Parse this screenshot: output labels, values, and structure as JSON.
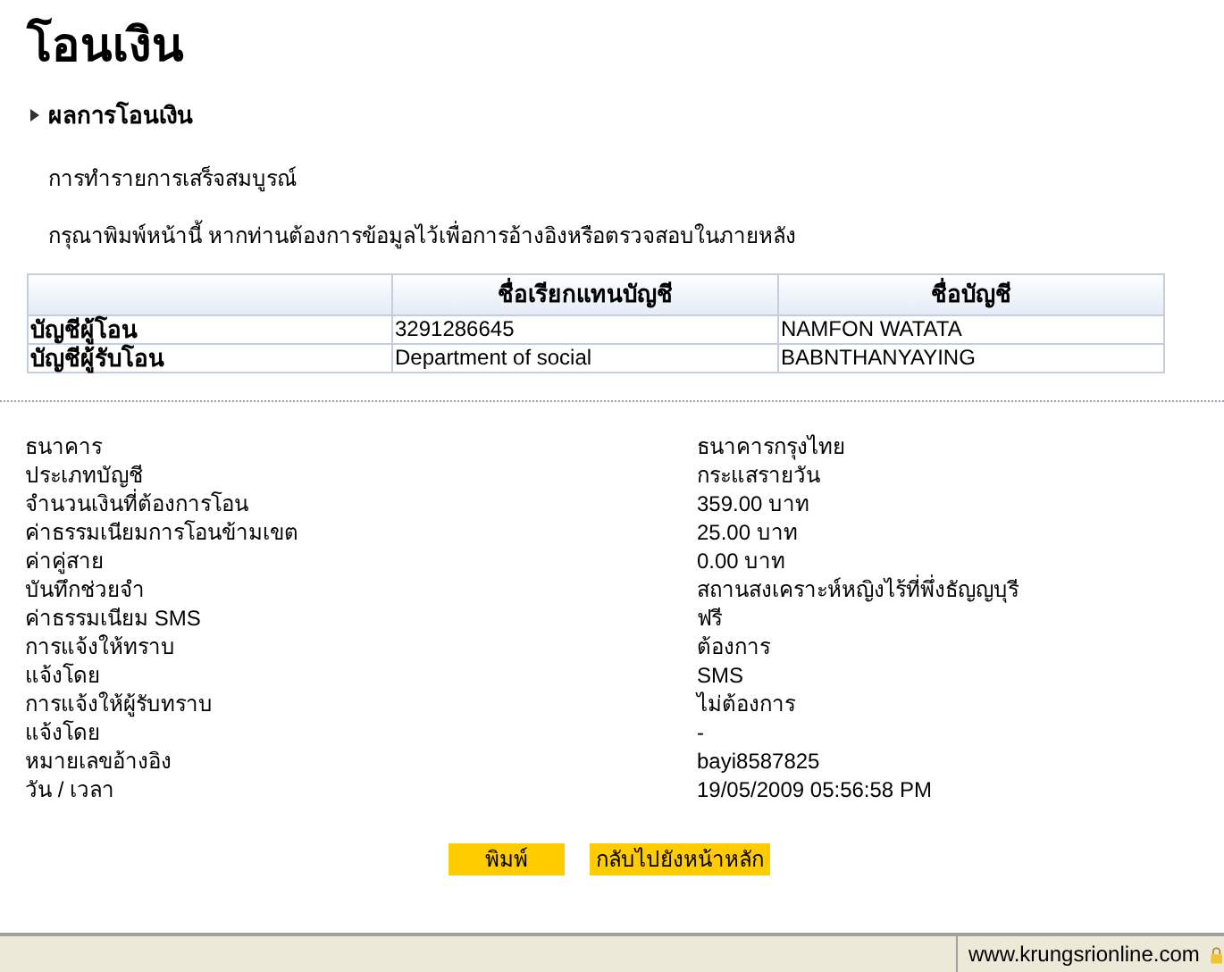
{
  "page_title": "โอนเงิน",
  "section": "ผลการโอนเงิน",
  "messages": [
    "การทำรายการเสร็จสมบูรณ์",
    "กรุณาพิมพ์หน้านี้ หากท่านต้องการข้อมูลไว้เพื่อการอ้างอิงหรือตรวจสอบในภายหลัง"
  ],
  "accounts_table": {
    "columns": [
      "ชื่อเรียกแทนบัญชี",
      "ชื่อบัญชี"
    ],
    "rows": [
      {
        "label": "บัญชีผู้โอน",
        "cells": [
          "3291286645",
          "NAMFON WATATA"
        ]
      },
      {
        "label": "บัญชีผู้รับโอน",
        "cells": [
          "Department of social",
          "BABNTHANYAYING"
        ]
      }
    ]
  },
  "details": [
    {
      "label": "ธนาคาร",
      "value": "ธนาคารกรุงไทย"
    },
    {
      "label": "ประเภทบัญชี",
      "value": "กระแสรายวัน"
    },
    {
      "label": "จำนวนเงินที่ต้องการโอน",
      "value": "359.00 บาท"
    },
    {
      "label": "ค่าธรรมเนียมการโอนข้ามเขต",
      "value": "25.00 บาท"
    },
    {
      "label": "ค่าคู่สาย",
      "value": "0.00 บาท"
    },
    {
      "label": "บันทึกช่วยจำ",
      "value": "สถานสงเคราะห์หญิงไร้ที่พึ่งธัญญบุรี"
    },
    {
      "label": "ค่าธรรมเนียม SMS",
      "value": "ฟรี"
    },
    {
      "label": "การแจ้งให้ทราบ",
      "value": "ต้องการ"
    },
    {
      "label": "แจ้งโดย",
      "value": "SMS"
    },
    {
      "label": "การแจ้งให้ผู้รับทราบ",
      "value": "ไม่ต้องการ"
    },
    {
      "label": "แจ้งโดย",
      "value": "-"
    },
    {
      "label": "หมายเลขอ้างอิง",
      "value": "bayi8587825"
    },
    {
      "label": "วัน / เวลา",
      "value": "19/05/2009 05:56:58 PM"
    }
  ],
  "buttons": [
    "พิมพ์",
    "กลับไปยังหน้าหลัก"
  ],
  "status_bar": {
    "url": "www.krungsrionline.com"
  }
}
